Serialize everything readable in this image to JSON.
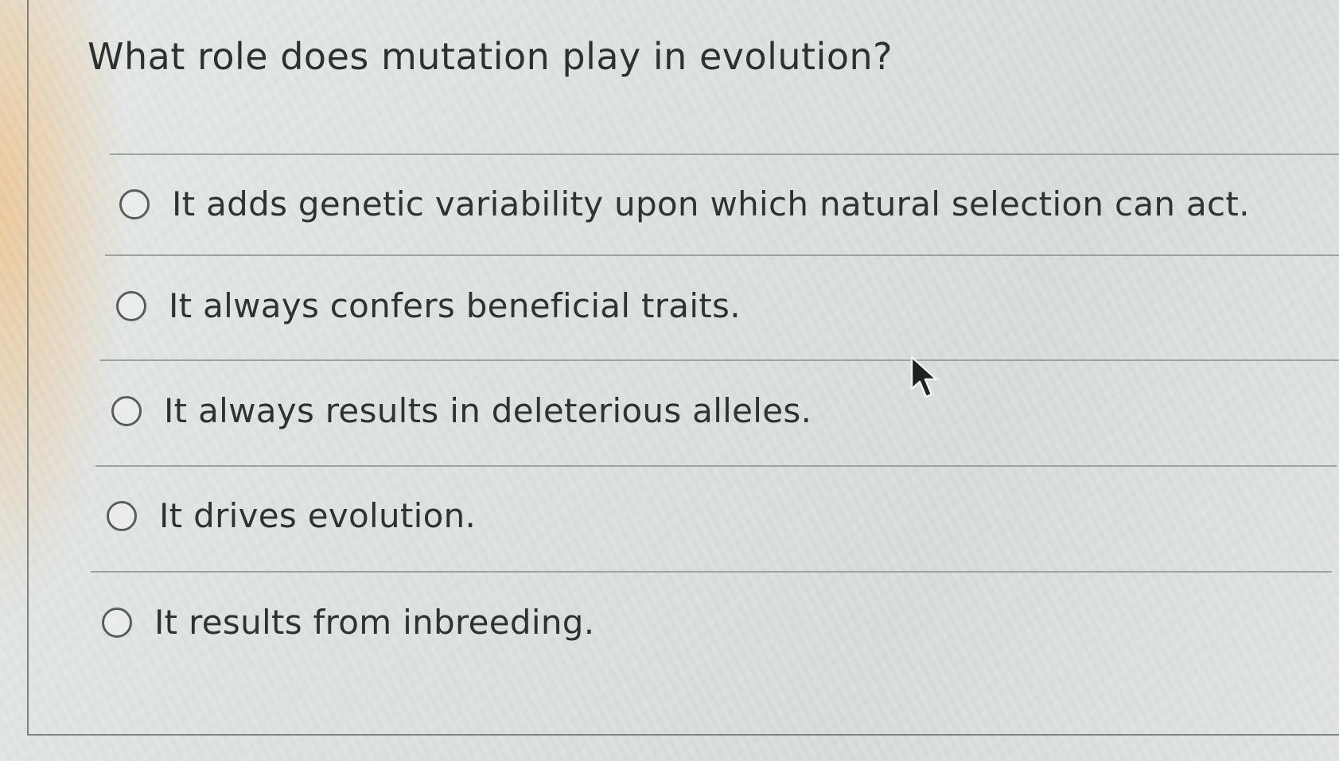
{
  "question": {
    "prompt": "What role does mutation play in evolution?"
  },
  "options": [
    {
      "label": "It adds genetic variability upon which natural selection can act.",
      "selected": false
    },
    {
      "label": "It always confers beneficial traits.",
      "selected": false
    },
    {
      "label": "It always results in deleterious alleles.",
      "selected": false
    },
    {
      "label": "It drives evolution.",
      "selected": false
    },
    {
      "label": "It results from inbreeding.",
      "selected": false
    }
  ],
  "icons": {
    "radio": "radio-unselected-icon",
    "cursor": "mouse-pointer-icon"
  }
}
